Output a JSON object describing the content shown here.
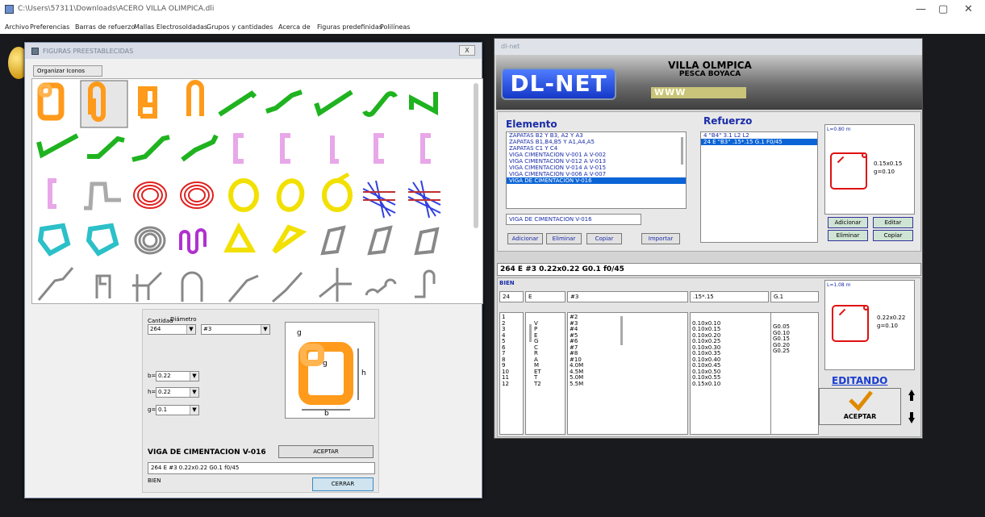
{
  "window": {
    "title": "C:\\Users\\57311\\Downloads\\ACERO VILLA OLIMPICA.dli"
  },
  "menu": [
    "Archivo",
    "Preferencias",
    "Barras de refuerzo",
    "Mallas Electrosoldadas",
    "Grupos y cantidades",
    "Acerca de",
    "Figuras predefinidas",
    "Polilíneas"
  ],
  "figuras": {
    "title": "FIGURAS PREESTABLECIDAS",
    "close": "X",
    "tab": "Organizar Iconos",
    "cantidad_label": "Cantidad",
    "cantidad": "264",
    "diametro_label": "Diámetro",
    "diametro": "#3",
    "b_label": "b=",
    "b": "0.22",
    "h_label": "h=",
    "h": "0.22",
    "g_label": "g=",
    "g": "0.1",
    "fig_g": "g",
    "fig_g2": "g",
    "fig_h": "h",
    "fig_b": "b",
    "element_name": "VIGA DE CIMENTACION V-016",
    "aceptar": "ACEPTAR",
    "summary": "264 E #3 0.22x0.22 G0.1 f0/45",
    "status": "BIEN",
    "cerrar": "CERRAR"
  },
  "dlnet": {
    "title": "dl-net",
    "logo": "DL-NET",
    "project_name": "VILLA OLMPICA",
    "project_location": "PESCA BOYACA",
    "www": "WWW",
    "elemento_label": "Elemento",
    "elementos": [
      "ZAPATAS B2 Y B3, A2 Y A3",
      "ZAPATAS B1,B4,B5 Y A1,A4,A5",
      "ZAPATAS C1 Y C4",
      "VIGA CIMENTACION V-001 A V-002",
      "VIGA CIMENTACION V-012 A V-013",
      "VIGA CIMENTACION V-014 A V-015",
      "VIGA CIMENTACION V-006 A V-007",
      "VIGA DE CIMENTACION V-016"
    ],
    "element_input": "VIGA DE CIMENTACION V-016",
    "adicionar": "Adicionar",
    "eliminar": "Eliminar",
    "copiar": "Copiar",
    "importar": "Importar",
    "refuerzo_label": "Refuerzo",
    "refuerzos": [
      "4 \"B4\" 3.1  L2  L2",
      "24  E  \"B3\"  .15*.15  G.1  F0/45"
    ],
    "preview1": {
      "length": "L=0.80 m",
      "dims": "0.15x0.15",
      "g": "g=0.10"
    },
    "editar": "Editar",
    "summary": "264 E #3 0.22x0.22 G0.1 f0/45",
    "status": "BIEN",
    "fields": [
      "24",
      "E",
      "#3",
      ".15*.15",
      "G.1"
    ],
    "table": {
      "nums": [
        "1",
        "2",
        "3",
        "4",
        "5",
        "6",
        "7",
        "8",
        "9",
        "10",
        "11",
        "12"
      ],
      "codes": [
        "",
        "V",
        "P",
        "E",
        "G",
        "C",
        "R",
        "A",
        "M",
        "ET",
        "T",
        "T2"
      ],
      "diams": [
        "#2",
        "#3",
        "#4",
        "#5",
        "#6",
        "#7",
        "#8",
        "#10",
        "4.0M",
        "4.5M",
        "5.0M",
        "5.5M"
      ],
      "sizes": [
        "",
        "0.10x0.10",
        "0.10x0.15",
        "0.10x0.20",
        "0.10x0.25",
        "0.10x0.30",
        "0.10x0.35",
        "0.10x0.40",
        "0.10x0.45",
        "0.10x0.50",
        "0.10x0.55",
        "0.15x0.10"
      ],
      "gs": [
        "",
        "G0.05",
        "G0.10",
        "G0.15",
        "G0.20",
        "G0.25"
      ]
    },
    "preview2": {
      "length": "L=1.08 m",
      "dims": "0.22x0.22",
      "g": "g=0.10"
    },
    "editando": "EDITANDO",
    "aceptar": "ACEPTAR"
  }
}
